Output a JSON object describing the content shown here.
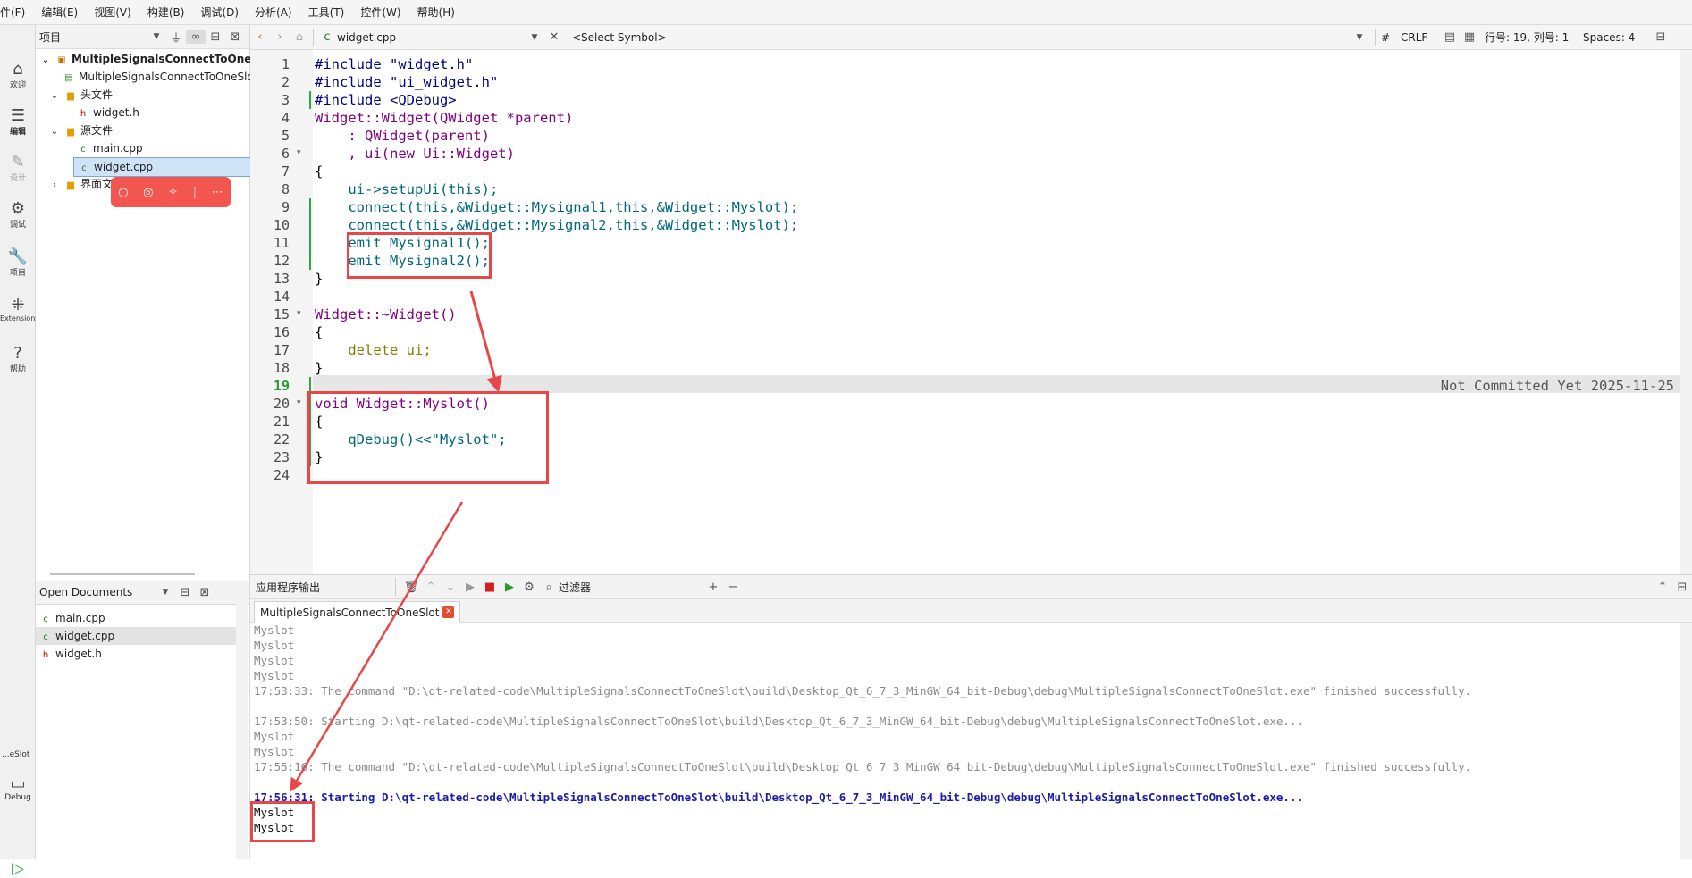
{
  "menu": [
    "件(F)",
    "编辑(E)",
    "视图(V)",
    "构建(B)",
    "调试(D)",
    "分析(A)",
    "工具(T)",
    "控件(W)",
    "帮助(H)"
  ],
  "modes": [
    {
      "icon": "home-icon",
      "label": "欢迎"
    },
    {
      "icon": "edit-icon",
      "label": "编辑"
    },
    {
      "icon": "design-icon",
      "label": "设计"
    },
    {
      "icon": "debug-icon",
      "label": "调试"
    },
    {
      "icon": "projects-icon",
      "label": "项目"
    },
    {
      "icon": "extensions-icon",
      "label": "Extensions"
    },
    {
      "icon": "help-icon",
      "label": "帮助"
    }
  ],
  "mode_bottom": {
    "target": "...eSlot",
    "kit": "Debug"
  },
  "project_pane": {
    "selector": "项目",
    "tree": [
      {
        "label": "MultipleSignalsConnectToOneSlot",
        "icon": "project-icon"
      },
      {
        "label": "MultipleSignalsConnectToOneSlot.pro",
        "icon": "pro-file-icon"
      },
      {
        "label": "头文件",
        "icon": "folder-icon"
      },
      {
        "label": "widget.h",
        "icon": "header-file-icon"
      },
      {
        "label": "源文件",
        "icon": "folder-icon"
      },
      {
        "label": "main.cpp",
        "icon": "cpp-file-icon"
      },
      {
        "label": "widget.cpp",
        "icon": "cpp-file-icon"
      },
      {
        "label": "界面文件",
        "icon": "folder-icon"
      }
    ]
  },
  "open_documents": {
    "title": "Open Documents",
    "files": [
      "main.cpp",
      "widget.cpp",
      "widget.h"
    ]
  },
  "editor_toolbar": {
    "file": "widget.cpp",
    "symbol": "<Select Symbol>",
    "hash": "#",
    "line_ending": "CRLF",
    "position": "行号: 19, 列号: 1",
    "spaces": "Spaces: 4"
  },
  "code": {
    "line_numbers": [
      "1",
      "2",
      "3",
      "4",
      "5",
      "6",
      "7",
      "8",
      "9",
      "10",
      "11",
      "12",
      "13",
      "14",
      "15",
      "16",
      "17",
      "18",
      "19",
      "20",
      "21",
      "22",
      "23",
      "24"
    ],
    "lines": [
      "#include \"widget.h\"",
      "#include \"ui_widget.h\"",
      "#include <QDebug>",
      "Widget::Widget(QWidget *parent)",
      "    : QWidget(parent)",
      "    , ui(new Ui::Widget)",
      "{",
      "    ui->setupUi(this);",
      "    connect(this,&Widget::Mysignal1,this,&Widget::Myslot);",
      "    connect(this,&Widget::Mysignal2,this,&Widget::Myslot);",
      "    emit Mysignal1();",
      "    emit Mysignal2();",
      "}",
      "",
      "Widget::~Widget()",
      "{",
      "    delete ui;",
      "}",
      "",
      "void Widget::Myslot()",
      "{",
      "    qDebug()<<\"Myslot\";",
      "}",
      ""
    ],
    "blame_annotation": "Not Committed Yet 2025-11-25"
  },
  "output_pane": {
    "title": "应用程序输出",
    "filter": "过滤器",
    "tab": "MultipleSignalsConnectToOneSlot",
    "lines": [
      "Myslot",
      "Myslot",
      "Myslot",
      "Myslot",
      "17:53:33: The command \"D:\\qt-related-code\\MultipleSignalsConnectToOneSlot\\build\\Desktop_Qt_6_7_3_MinGW_64_bit-Debug\\debug\\MultipleSignalsConnectToOneSlot.exe\" finished successfully.",
      "",
      "17:53:50: Starting D:\\qt-related-code\\MultipleSignalsConnectToOneSlot\\build\\Desktop_Qt_6_7_3_MinGW_64_bit-Debug\\debug\\MultipleSignalsConnectToOneSlot.exe...",
      "Myslot",
      "Myslot",
      "17:55:16: The command \"D:\\qt-related-code\\MultipleSignalsConnectToOneSlot\\build\\Desktop_Qt_6_7_3_MinGW_64_bit-Debug\\debug\\MultipleSignalsConnectToOneSlot.exe\" finished successfully.",
      "",
      "17:56:31: Starting D:\\qt-related-code\\MultipleSignalsConnectToOneSlot\\build\\Desktop_Qt_6_7_3_MinGW_64_bit-Debug\\debug\\MultipleSignalsConnectToOneSlot.exe...",
      "Myslot",
      "Myslot"
    ]
  },
  "colors": {
    "annotation_red": "#e8474a",
    "accent_blue": "#1c1ca8",
    "selection": "#cfe3f7"
  }
}
